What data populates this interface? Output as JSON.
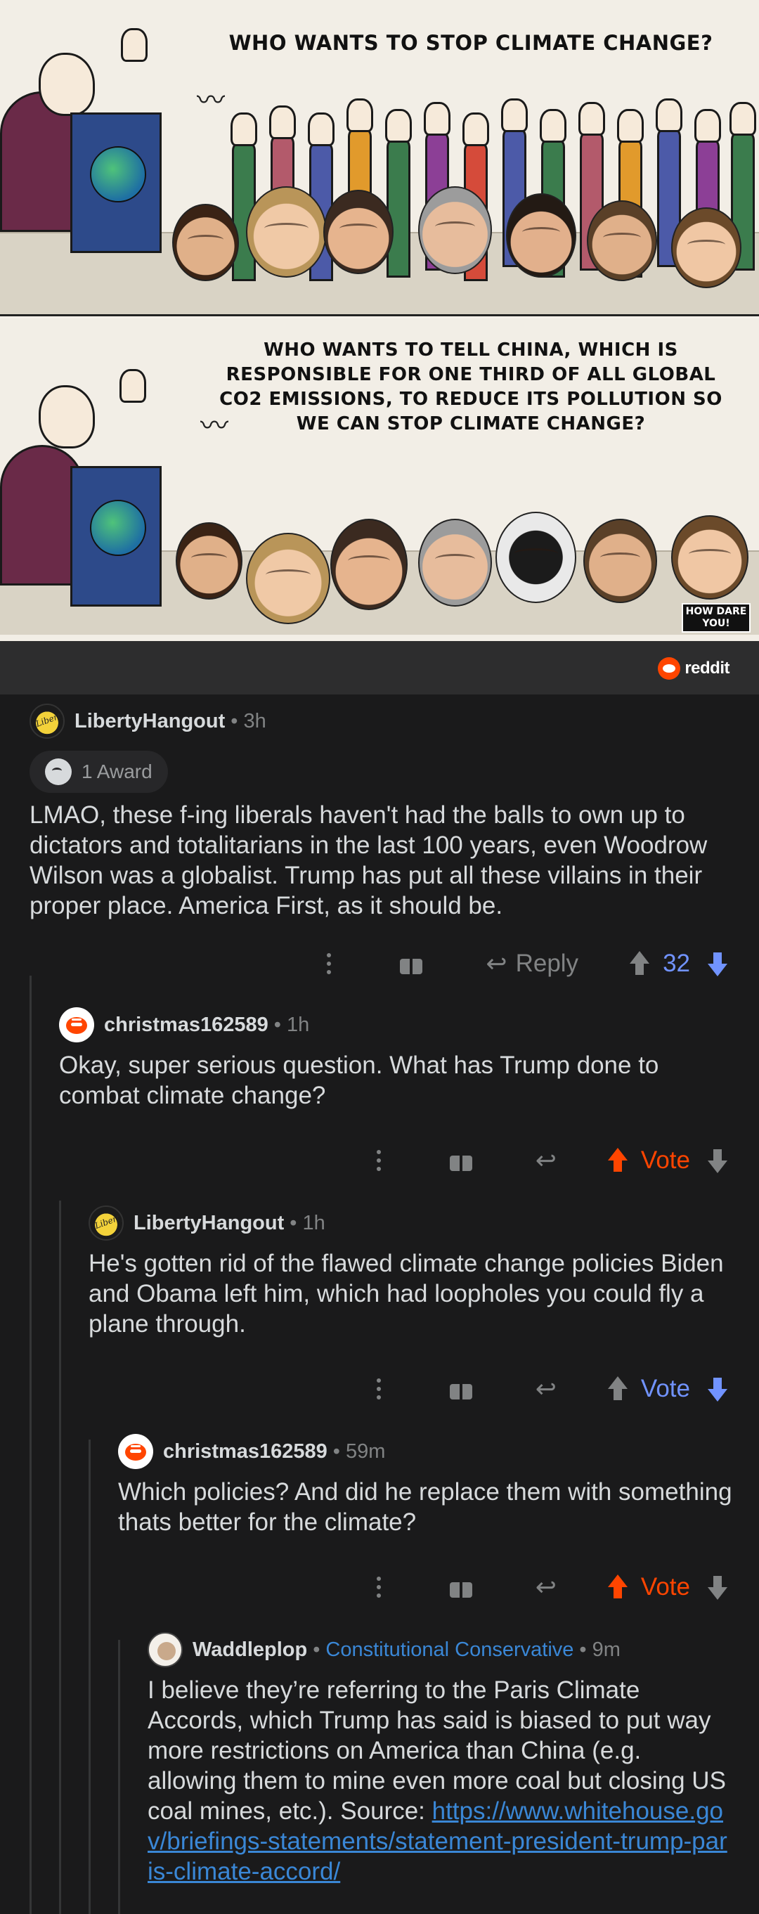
{
  "meme": {
    "panel1_caption": "WHO WANTS TO STOP CLIMATE CHANGE?",
    "panel2_caption": "WHO WANTS TO TELL CHINA, WHICH IS RESPONSIBLE FOR ONE THIRD OF ALL GLOBAL CO2 EMISSIONS, TO REDUCE ITS POLLUTION SO WE CAN STOP CLIMATE CHANGE?",
    "how_dare": "HOW DARE YOU!"
  },
  "watermark": {
    "label": "reddit",
    "color": "#ff4500"
  },
  "comments": [
    {
      "username": "LibertyHangout",
      "avatar_text": "Liberty",
      "time": "3h",
      "award": "1 Award",
      "body": "LMAO, these f-ing liberals haven't had the balls to own up to dictators and totalitarians in the last 100 years, even Woodrow Wilson was a globalist. Trump has put all these villains in their proper place. America First, as it should be.",
      "reply_label": "Reply",
      "vote": "32",
      "vote_state": "up"
    },
    {
      "username": "christmas162589",
      "time": "1h",
      "body": "Okay, super serious question. What has Trump done to combat climate change?",
      "vote": "Vote",
      "vote_state": "up"
    },
    {
      "username": "LibertyHangout",
      "avatar_text": "Liberty",
      "time": "1h",
      "body": "He's gotten rid of the flawed climate change policies Biden and Obama left him, which had loopholes you could fly a plane through.",
      "vote": "Vote",
      "vote_state": "down"
    },
    {
      "username": "christmas162589",
      "time": "59m",
      "body": "Which policies? And did he replace them with something thats better for the climate?",
      "vote": "Vote",
      "vote_state": "up"
    },
    {
      "username": "Waddleplop",
      "flair": "Constitutional Conservative",
      "time": "9m",
      "body": "I believe they’re referring to the Paris Climate Accords, which Trump has said is biased to put way more restrictions on America than China (e.g. allowing them to mine even more coal but closing US coal mines, etc.). Source: ",
      "link": "https://www.whitehouse.gov/briefings-statements/statement-president-trump-paris-climate-accord/"
    }
  ],
  "colors": {
    "background": "#1a1a1b",
    "upvote": "#ff4500",
    "downvote": "#7193ff",
    "link": "#3a87d6",
    "muted": "#818384"
  }
}
